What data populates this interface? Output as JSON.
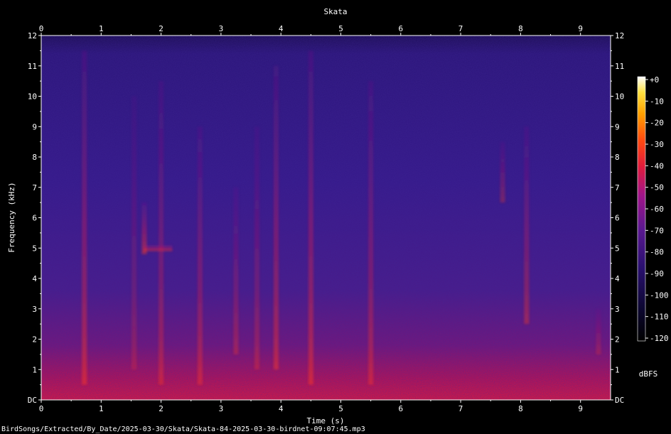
{
  "chart_data": {
    "type": "heatmap",
    "title": "Skata",
    "xlabel": "Time (s)",
    "ylabel": "Frequency (kHz)",
    "xlim": [
      0,
      9.5
    ],
    "ylim": [
      0,
      12
    ],
    "x_ticks": [
      "0",
      "1",
      "2",
      "3",
      "4",
      "5",
      "6",
      "7",
      "8",
      "9"
    ],
    "y_ticks": [
      "DC",
      "1",
      "2",
      "3",
      "4",
      "5",
      "6",
      "7",
      "8",
      "9",
      "10",
      "11",
      "12"
    ],
    "colorbar": {
      "label": "dBFS",
      "range": [
        -120,
        0
      ],
      "ticks": [
        "+0",
        "-10",
        "-20",
        "-30",
        "-40",
        "-50",
        "-60",
        "-70",
        "-80",
        "-90",
        "-100",
        "-110",
        "-120"
      ]
    },
    "calls": [
      {
        "t": 0.72,
        "fmin": 0.5,
        "fmax": 11.5,
        "level": -45
      },
      {
        "t": 1.55,
        "fmin": 1.0,
        "fmax": 10.0,
        "level": -70
      },
      {
        "t": 1.72,
        "fmin": 4.8,
        "fmax": 6.5,
        "level": -45
      },
      {
        "t": 1.95,
        "fmin": 4.9,
        "fmax": 5.1,
        "level": -40
      },
      {
        "t": 2.0,
        "fmin": 0.5,
        "fmax": 10.5,
        "level": -55
      },
      {
        "t": 2.65,
        "fmin": 0.5,
        "fmax": 9.0,
        "level": -52
      },
      {
        "t": 3.25,
        "fmin": 1.5,
        "fmax": 7.0,
        "level": -60
      },
      {
        "t": 3.6,
        "fmin": 1.0,
        "fmax": 9.0,
        "level": -62
      },
      {
        "t": 3.92,
        "fmin": 1.0,
        "fmax": 11.0,
        "level": -48
      },
      {
        "t": 4.5,
        "fmin": 0.5,
        "fmax": 11.5,
        "level": -45
      },
      {
        "t": 5.5,
        "fmin": 0.5,
        "fmax": 10.5,
        "level": -52
      },
      {
        "t": 7.7,
        "fmin": 6.5,
        "fmax": 8.5,
        "level": -62
      },
      {
        "t": 8.1,
        "fmin": 2.5,
        "fmax": 9.0,
        "level": -55
      },
      {
        "t": 9.3,
        "fmin": 1.5,
        "fmax": 3.0,
        "level": -65
      }
    ]
  },
  "footer": {
    "file_path": "BirdSongs/Extracted/By_Date/2025-03-30/Skata/Skata-84-2025-03-30-birdnet-09:07:45.mp3"
  }
}
